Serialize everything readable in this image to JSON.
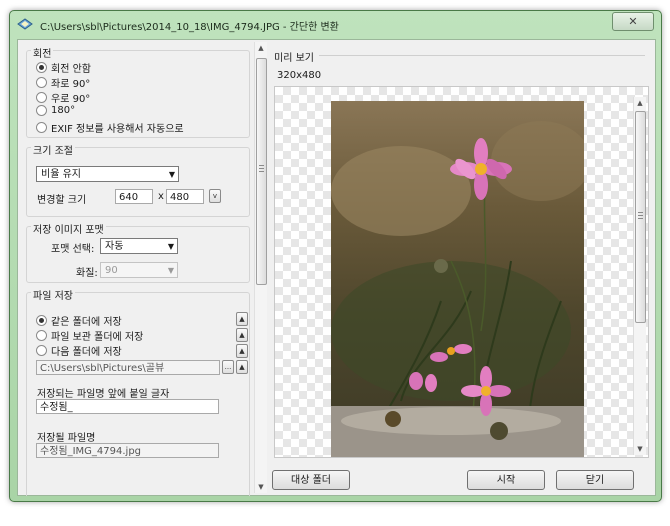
{
  "window": {
    "title": "C:\\Users\\sbl\\Pictures\\2014_10_18\\IMG_4794.JPG - 간단한 변환",
    "close_glyph": "✕"
  },
  "rotation": {
    "label": "회전",
    "options": [
      "회전 안함",
      "좌로 90°",
      "우로 90°",
      "180°",
      "EXIF 정보를 사용해서 자동으로"
    ],
    "selected": "회전 안함"
  },
  "resize": {
    "label": "크기 조절",
    "mode": "비율 유지",
    "size_label": "변경할 크기",
    "width": "640",
    "times": "x",
    "height": "480",
    "spin_glyph": "v"
  },
  "format": {
    "label": "저장 이미지 포맷",
    "format_label": "포맷 선택:",
    "format_value": "자동",
    "quality_label": "화질:",
    "quality_value": "90"
  },
  "save": {
    "label": "파일 저장",
    "options": [
      "같은 폴더에 저장",
      "파일 보관 폴더에 저장",
      "다음 폴더에 저장"
    ],
    "selected": "같은 폴더에 저장",
    "folder_path": "C:\\Users\\sbl\\Pictures\\골뷰",
    "browse_label": "...",
    "prefix_label": "저장되는 파일명 앞에 붙일 글자",
    "prefix_value": "수정됨_",
    "filename_label": "저장될 파일명",
    "filename_value": "수정됨_IMG_4794.jpg"
  },
  "preview": {
    "label": "미리 보기",
    "size": "320x480"
  },
  "buttons": {
    "target_folder": "대상 폴더",
    "start": "시작",
    "close": "닫기"
  },
  "icons": {
    "app": "image-convert-icon",
    "close": "close-icon",
    "up": "arrow-up-icon",
    "down": "arrow-down-icon"
  }
}
